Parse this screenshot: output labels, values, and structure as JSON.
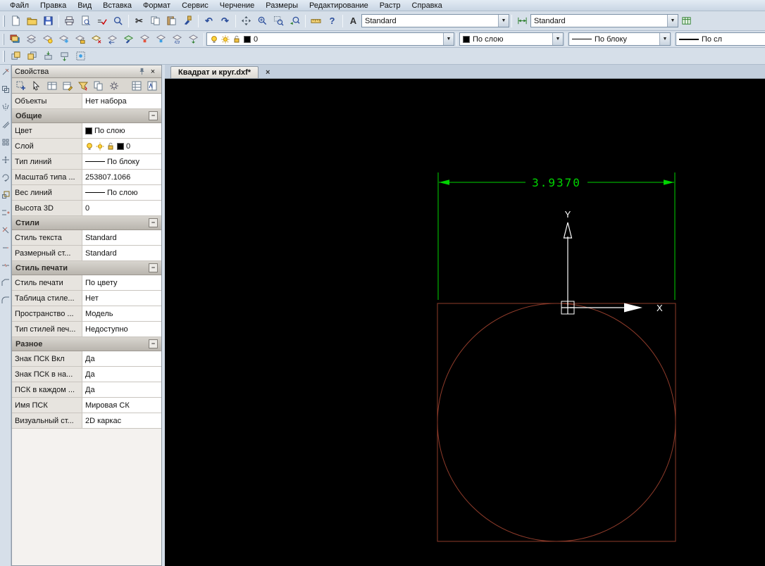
{
  "colors": {
    "dim-green": "#00d400",
    "geom-red": "#8e3b2a",
    "ucs-white": "#ffffff",
    "chrome-bg": "#d6dfe9",
    "drawing-bg": "#000000"
  },
  "icons": {
    "collapse": "−",
    "close": "×",
    "dropdown": "▼",
    "cut": "✂",
    "undo": "↶",
    "redo": "↷",
    "help": "?",
    "text_style": "A"
  },
  "menu": {
    "items": [
      "Файл",
      "Правка",
      "Вид",
      "Вставка",
      "Формат",
      "Сервис",
      "Черчение",
      "Размеры",
      "Редактирование",
      "Растр",
      "Справка"
    ]
  },
  "toolbar": {
    "text_style_value": "Standard",
    "dim_style_value": "Standard",
    "layer_value": "0",
    "color_value": "По слою",
    "linetype_value": "По блоку",
    "lineweight_value": "По сл"
  },
  "tab": {
    "label": "Квадрат и круг.dxf*"
  },
  "properties": {
    "title": "Свойства",
    "selection": {
      "label": "Объекты",
      "value": "Нет набора"
    },
    "sections": [
      {
        "title": "Общие",
        "rows": [
          {
            "label": "Цвет",
            "value": "По слою"
          },
          {
            "label": "Слой",
            "value": "0"
          },
          {
            "label": "Тип линий",
            "value": "По блоку"
          },
          {
            "label": "Масштаб типа ...",
            "value": "253807.1066"
          },
          {
            "label": "Вес линий",
            "value": "По слою"
          },
          {
            "label": "Высота 3D",
            "value": "0"
          }
        ]
      },
      {
        "title": "Стили",
        "rows": [
          {
            "label": "Стиль текста",
            "value": "Standard"
          },
          {
            "label": "Размерный ст...",
            "value": "Standard"
          }
        ]
      },
      {
        "title": "Стиль печати",
        "rows": [
          {
            "label": "Стиль печати",
            "value": "По цвету"
          },
          {
            "label": "Таблица стиле...",
            "value": "Нет"
          },
          {
            "label": "Пространство ...",
            "value": "Модель"
          },
          {
            "label": "Тип стилей печ...",
            "value": "Недоступно"
          }
        ]
      },
      {
        "title": "Разное",
        "rows": [
          {
            "label": "Знак ПСК Вкл",
            "value": "Да"
          },
          {
            "label": "Знак ПСК в на...",
            "value": "Да"
          },
          {
            "label": "ПСК в каждом ...",
            "value": "Да"
          },
          {
            "label": "Имя ПСК",
            "value": "Мировая СК"
          },
          {
            "label": "Визуальный ст...",
            "value": "2D каркас"
          }
        ]
      }
    ]
  },
  "drawing": {
    "dimension_text": "3.9370",
    "ucs_x_label": "X",
    "ucs_y_label": "Y"
  }
}
